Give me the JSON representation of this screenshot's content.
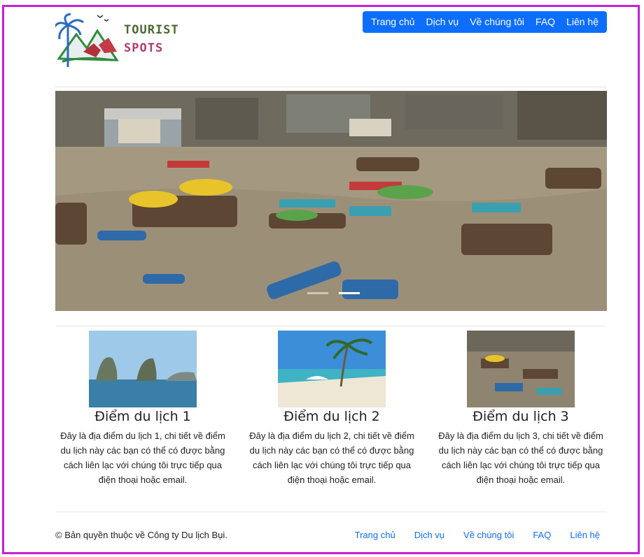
{
  "logo": {
    "line1": "TOURIST",
    "line2": "SPOTS"
  },
  "nav": {
    "items": [
      "Trang chủ",
      "Dịch vụ",
      "Về chúng tôi",
      "FAQ",
      "Liên hệ"
    ]
  },
  "cards": [
    {
      "title": "Điểm du lịch 1",
      "text": "Đây là địa điểm du lịch 1, chi tiết về điểm du lịch này các bạn có thể có được bằng cách liên lạc với chúng tôi trực tiếp qua điện thoại hoặc email."
    },
    {
      "title": "Điểm du lịch 2",
      "text": "Đây là địa điểm du lịch 2, chi tiết về điểm du lịch này các bạn có thể có được bằng cách liên lạc với chúng tôi trực tiếp qua điện thoại hoặc email."
    },
    {
      "title": "Điểm du lịch 3",
      "text": "Đây là địa điểm du lịch 3, chi tiết về điểm du lịch này các bạn có thể có được bằng cách liên lạc với chúng tôi trực tiếp qua điện thoại hoặc email."
    }
  ],
  "footer": {
    "copyright": "© Bản quyền thuộc về Công ty Du lịch Bụi.",
    "links": [
      "Trang chủ",
      "Dịch vụ",
      "Về chúng tôi",
      "FAQ",
      "Liên hệ"
    ]
  },
  "colors": {
    "brand": "#0d6efd",
    "frame": "#c81fd8"
  }
}
